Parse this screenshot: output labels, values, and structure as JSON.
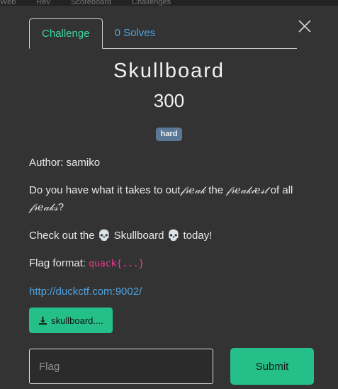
{
  "top_strip": [
    "Web",
    "Rev",
    "Scoreboard",
    "Challenges"
  ],
  "tabs": [
    {
      "label": "Challenge",
      "active": true
    },
    {
      "label": "0 Solves",
      "active": false
    }
  ],
  "challenge": {
    "name": "Skullboard",
    "points": "300",
    "difficulty": "hard",
    "author_line": "Author: samiko",
    "desc_part1": "Do you have what it takes to out",
    "desc_fancy1": "𝒻𝓇𝑒𝒶𝓀",
    "desc_part2": "the",
    "desc_fancy2": "𝒻𝓇𝑒𝒶𝓀𝒾𝑒𝓈𝓉",
    "desc_part3": "of all",
    "desc_fancy3": "𝒻𝓇𝑒𝒶𝓀𝓈",
    "desc_part4": "?",
    "checkout_pre": "Check out the",
    "checkout_mid": "Skullboard",
    "checkout_post": "today!",
    "skull_glyph": "💀",
    "flag_format_label": "Flag format:",
    "flag_format_code": "quack{...}",
    "link": "http://duckctf.com:9002/",
    "file_label": "skullboard...."
  },
  "form": {
    "flag_placeholder": "Flag",
    "flag_value": "",
    "submit_label": "Submit"
  },
  "colors": {
    "accent": "#25c08a",
    "active_tab": "#3fd39f",
    "link": "#4fa3e0",
    "badge": "#5a7796",
    "code": "#e83e8c",
    "background": "#333333"
  },
  "icons": {
    "close": "close-icon",
    "download": "download-icon",
    "skull": "skull-icon"
  }
}
